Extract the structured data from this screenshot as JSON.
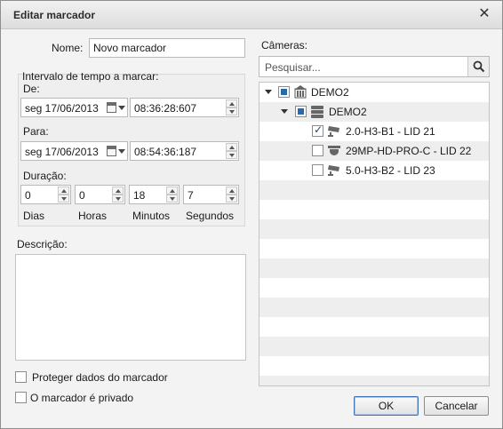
{
  "window": {
    "title": "Editar marcador"
  },
  "form": {
    "name_label": "Nome:",
    "name_value": "Novo marcador",
    "interval_label": "Intervalo de tempo a marcar:",
    "from_label": "De:",
    "from_date": "seg  17/06/2013",
    "from_time": "08:36:28:607",
    "to_label": "Para:",
    "to_date": "seg  17/06/2013",
    "to_time": "08:54:36:187",
    "duration_label": "Duração:",
    "duration": [
      {
        "value": "0",
        "unit": "Dias"
      },
      {
        "value": "0",
        "unit": "Horas"
      },
      {
        "value": "18",
        "unit": "Minutos"
      },
      {
        "value": "7",
        "unit": "Segundos"
      }
    ],
    "description_label": "Descrição:",
    "protect_label": "Proteger dados do marcador",
    "private_label": "O marcador é privado"
  },
  "cameras": {
    "label": "Câmeras:",
    "search_placeholder": "Pesquisar...",
    "tree": [
      {
        "label": "DEMO2",
        "icon": "site-building-icon",
        "state": "partial"
      },
      {
        "label": "DEMO2",
        "icon": "server-icon",
        "state": "partial"
      },
      {
        "label": "2.0-H3-B1 - LID 21",
        "icon": "bullet-camera-icon",
        "state": "checked"
      },
      {
        "label": "29MP-HD-PRO-C - LID 22",
        "icon": "dome-camera-icon",
        "state": "unchecked"
      },
      {
        "label": "5.0-H3-B2 - LID 23",
        "icon": "bullet-camera-icon",
        "state": "unchecked"
      }
    ]
  },
  "buttons": {
    "ok": "OK",
    "cancel": "Cancelar"
  }
}
